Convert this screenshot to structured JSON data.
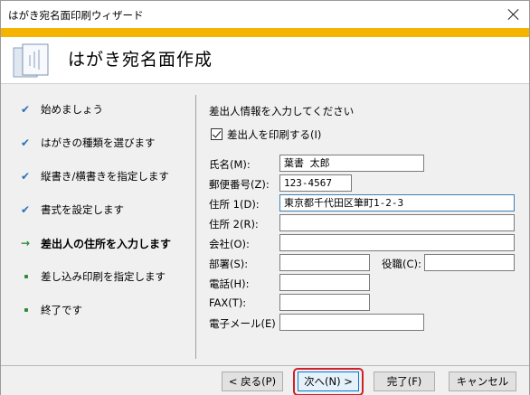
{
  "window": {
    "title": "はがき宛名面印刷ウィザード"
  },
  "header": {
    "title": "はがき宛名面作成"
  },
  "steps": [
    {
      "label": "始めましょう",
      "state": "done"
    },
    {
      "label": "はがきの種類を選びます",
      "state": "done"
    },
    {
      "label": "縦書き/横書きを指定します",
      "state": "done"
    },
    {
      "label": "書式を設定します",
      "state": "done"
    },
    {
      "label": "差出人の住所を入力します",
      "state": "current"
    },
    {
      "label": "差し込み印刷を指定します",
      "state": "pending"
    },
    {
      "label": "終了です",
      "state": "pending"
    }
  ],
  "form": {
    "heading": "差出人情報を入力してください",
    "print_sender_label": "差出人を印刷する(I)",
    "print_sender_checked": true,
    "name_label": "氏名(M):",
    "name_value": "葉書 太郎",
    "postal_label": "郵便番号(Z):",
    "postal_value": "123-4567",
    "address1_label": "住所 1(D):",
    "address1_value": "東京都千代田区筆町1-2-3",
    "address2_label": "住所 2(R):",
    "address2_value": "",
    "company_label": "会社(O):",
    "company_value": "",
    "dept_label": "部署(S):",
    "dept_value": "",
    "title_label": "役職(C):",
    "title_value": "",
    "phone_label": "電話(H):",
    "phone_value": "",
    "fax_label": "FAX(T):",
    "fax_value": "",
    "email_label": "電子メール(E)",
    "email_value": ""
  },
  "buttons": {
    "back": "< 戻る(P)",
    "next": "次へ(N) >",
    "finish": "完了(F)",
    "cancel": "キャンセル"
  },
  "colors": {
    "banner": "#f4b400",
    "focus_ring": "#d0202a",
    "check": "#2a6fb8",
    "current_arrow": "#2e8b3c"
  }
}
